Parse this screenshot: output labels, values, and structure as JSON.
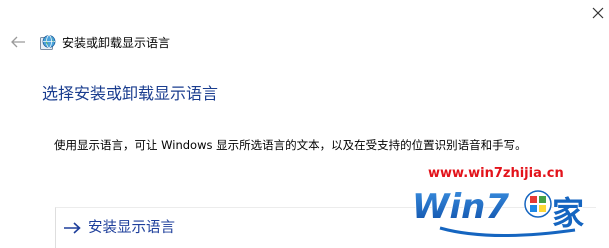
{
  "window": {
    "title": "安装或卸载显示语言"
  },
  "page": {
    "heading": "选择安装或卸载显示语言",
    "description": "使用显示语言，可让 Windows 显示所选语言的文本，以及在受支持的位置识别语音和手写。",
    "install_option_label": "安装显示语言"
  },
  "watermark": {
    "url": "www.win7zhijia.cn",
    "logo_text": "Win7",
    "logo_char": "家"
  },
  "colors": {
    "link": "#1e3f9b",
    "heading": "#1a3d8f",
    "watermark_red": "#e3131b",
    "watermark_blue": "#1565c0"
  },
  "icons": {
    "back": "back-arrow-icon",
    "title": "globe-language-icon",
    "link_arrow": "right-arrow-icon",
    "close": "close-icon"
  }
}
